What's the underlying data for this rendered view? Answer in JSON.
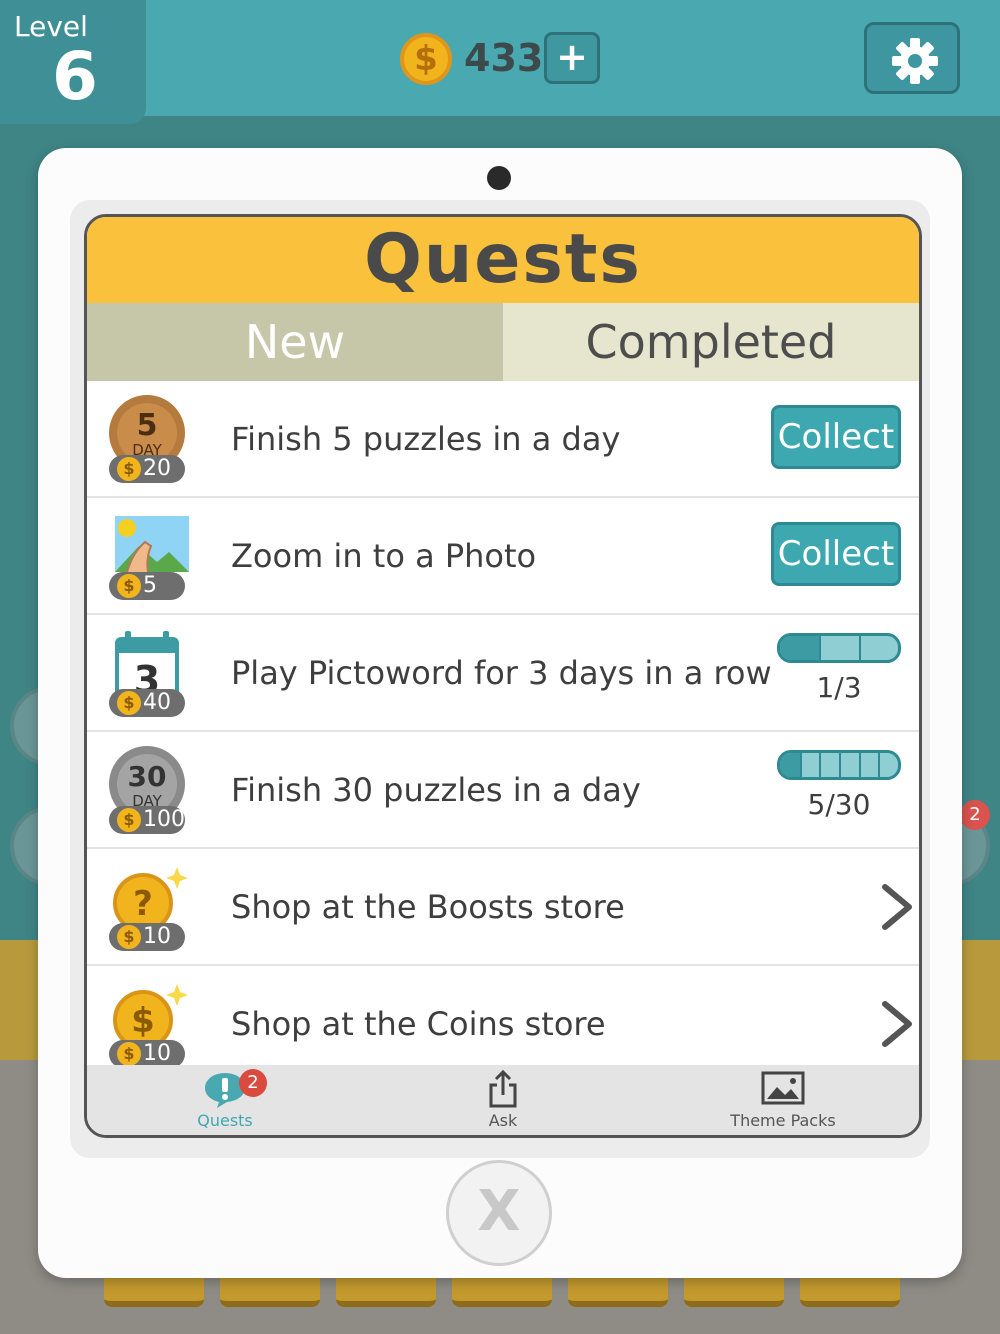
{
  "level": {
    "label": "Level",
    "value": "6"
  },
  "coins": {
    "symbol": "$",
    "count": "433",
    "add_label": "+"
  },
  "settings": {
    "icon": "gear-icon"
  },
  "dialog": {
    "title": "Quests",
    "tabs": [
      {
        "label": "New",
        "active": true
      },
      {
        "label": "Completed",
        "active": false
      }
    ],
    "quests": [
      {
        "text": "Finish 5 puzzles in a day",
        "reward": "20",
        "icon": "bronze-medal-icon",
        "medal_num": "5",
        "medal_sub": "DAY",
        "action": "collect",
        "action_label": "Collect"
      },
      {
        "text": "Zoom in to a Photo",
        "reward": "5",
        "icon": "photo-zoom-icon",
        "action": "collect",
        "action_label": "Collect"
      },
      {
        "text": "Play Pictoword for 3 days in a row",
        "reward": "40",
        "icon": "calendar-icon",
        "calendar_num": "3",
        "action": "progress",
        "progress_text": "1/3",
        "progress": 0.333,
        "segments": 3
      },
      {
        "text": "Finish 30 puzzles in a day",
        "reward": "100",
        "icon": "silver-medal-icon",
        "medal_num": "30",
        "medal_sub": "DAY",
        "action": "progress",
        "progress_text": "5/30",
        "progress": 0.167,
        "segments": 6
      },
      {
        "text": "Shop at the Boosts store",
        "reward": "10",
        "icon": "boost-coin-icon",
        "icon_glyph": "?",
        "action": "navigate"
      },
      {
        "text": "Shop at the Coins store",
        "reward": "10",
        "icon": "coin-store-icon",
        "icon_glyph": "$",
        "action": "navigate"
      }
    ],
    "nav": [
      {
        "label": "Quests",
        "icon": "quests-icon",
        "badge": "2",
        "active": true
      },
      {
        "label": "Ask",
        "icon": "share-icon"
      },
      {
        "label": "Theme Packs",
        "icon": "image-icon"
      }
    ],
    "close_label": "X"
  },
  "background": {
    "badge": "2"
  },
  "colors": {
    "accent": "#3ea8b1",
    "header": "#f9c13c",
    "topbar": "#4aa9b0"
  }
}
